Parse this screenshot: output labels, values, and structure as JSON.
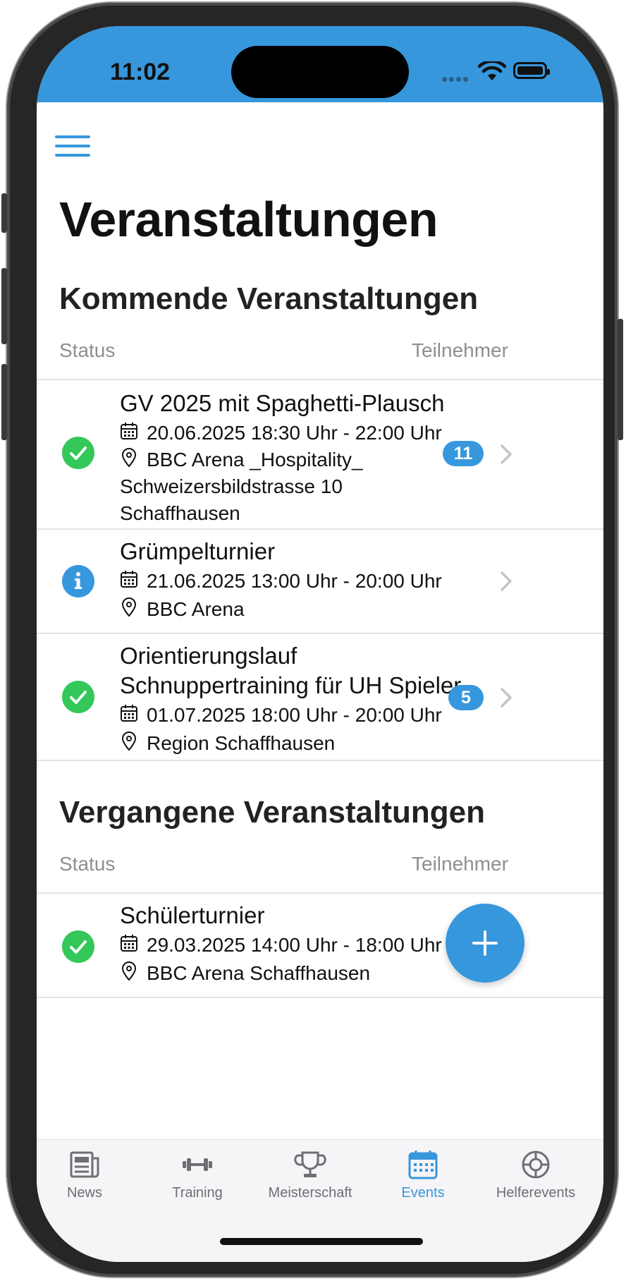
{
  "status_bar": {
    "time": "11:02"
  },
  "header": {
    "title": "Veranstaltungen"
  },
  "upcoming": {
    "title": "Kommende Veranstaltungen",
    "col_status": "Status",
    "col_participants": "Teilnehmer",
    "events": [
      {
        "title": "GV 2025 mit Spaghetti-Plausch",
        "datetime": "20.06.2025 18:30 Uhr - 22:00 Uhr",
        "location_lines": [
          "BBC Arena _Hospitality_",
          "Schweizersbildstrasse 10",
          "Schaffhausen"
        ],
        "status": "check",
        "participants": "11"
      },
      {
        "title": "Grümpelturnier",
        "datetime": "21.06.2025 13:00 Uhr - 20:00 Uhr",
        "location_lines": [
          "BBC Arena"
        ],
        "status": "info",
        "participants": ""
      },
      {
        "title_lines": [
          "Orientierungslauf",
          "Schnuppertraining für UH Spieler"
        ],
        "datetime": "01.07.2025 18:00 Uhr - 20:00 Uhr",
        "location_lines": [
          "Region Schaffhausen"
        ],
        "status": "check",
        "participants": "5"
      }
    ]
  },
  "past": {
    "title": "Vergangene Veranstaltungen",
    "col_status": "Status",
    "col_participants": "Teilnehmer",
    "events": [
      {
        "title": "Schülerturnier",
        "datetime": "29.03.2025 14:00 Uhr - 18:00 Uhr",
        "location_lines": [
          "BBC Arena Schaffhausen"
        ],
        "status": "check"
      }
    ]
  },
  "tabbar": {
    "tabs": [
      {
        "label": "News",
        "icon": "newspaper-icon"
      },
      {
        "label": "Training",
        "icon": "dumbbell-icon"
      },
      {
        "label": "Meisterschaft",
        "icon": "trophy-icon"
      },
      {
        "label": "Events",
        "icon": "calendar-icon",
        "active": true
      },
      {
        "label": "Helferevents",
        "icon": "lifebuoy-icon"
      }
    ]
  },
  "colors": {
    "accent": "#3797DD",
    "success": "#34C759",
    "secondary_text": "#8E8E93"
  }
}
